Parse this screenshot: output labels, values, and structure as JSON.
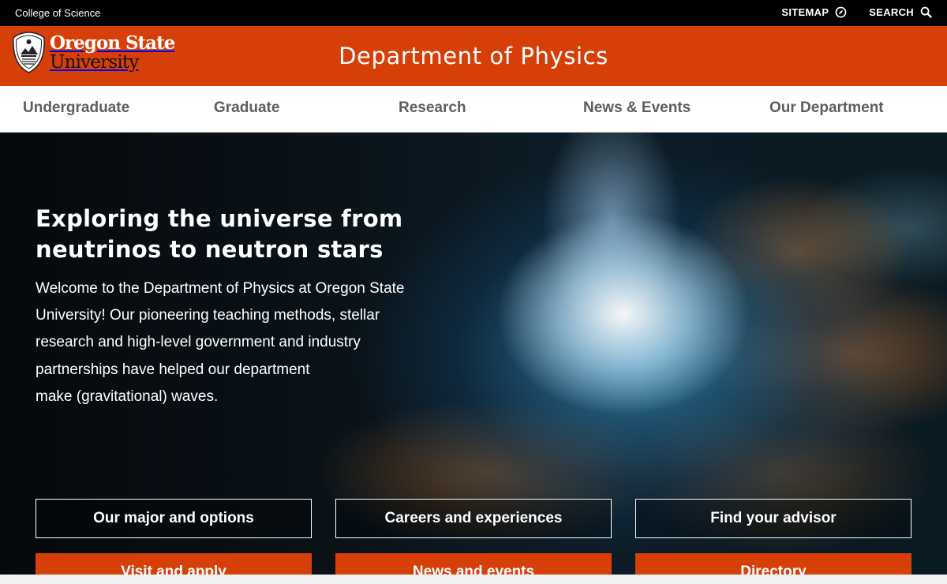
{
  "topbar": {
    "college": "College of Science",
    "sitemap": "SITEMAP",
    "search": "SEARCH"
  },
  "header": {
    "logo_line1": "Oregon State",
    "logo_line2": "University",
    "title": "Department of Physics",
    "accent_color": "#d73f09"
  },
  "nav": {
    "items": [
      {
        "label": "Undergraduate"
      },
      {
        "label": "Graduate"
      },
      {
        "label": "Research"
      },
      {
        "label": "News & Events"
      },
      {
        "label": "Our Department"
      }
    ]
  },
  "hero": {
    "title_line1": "Exploring the universe from",
    "title_line2": "neutrinos to neutron stars",
    "body_line1": "Welcome to the Department of Physics at Oregon State",
    "body_line2": "University! Our pioneering teaching methods, stellar",
    "body_line3": "research and high-level government and industry",
    "body_line4": "partnerships have helped our department",
    "body_line5": "make (gravitational) waves."
  },
  "buttons": {
    "outline": [
      {
        "label": "Our major and options"
      },
      {
        "label": "Careers and experiences"
      },
      {
        "label": "Find your advisor"
      }
    ],
    "solid": [
      {
        "label": "Visit and apply"
      },
      {
        "label": "News and events"
      },
      {
        "label": "Directory"
      }
    ]
  },
  "icons": {
    "sitemap": "compass-icon",
    "search": "search-icon",
    "logo": "osu-seal-icon"
  }
}
